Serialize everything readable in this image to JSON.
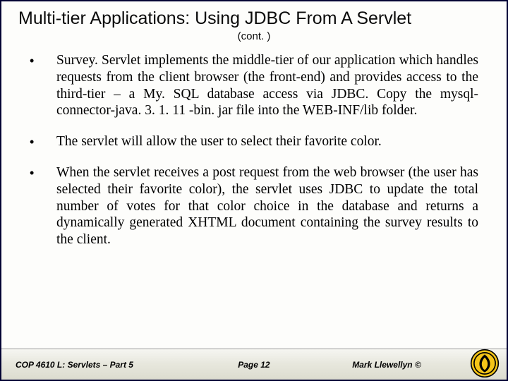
{
  "title": "Multi-tier Applications:  Using JDBC From A Servlet",
  "subtitle": "(cont. )",
  "bullets": [
    "Survey. Servlet implements the middle-tier of our application which handles requests from the client browser (the front-end) and provides access to the third-tier – a My. SQL database access via JDBC.  Copy the mysql-connector-java. 3. 1. 11 -bin. jar file into the WEB-INF/lib folder.",
    "The servlet will allow the user to select their favorite color.",
    "When the servlet receives a post request from the web browser (the user has selected their favorite color), the servlet uses JDBC to update the total number of votes for that color choice in the database and returns a dynamically generated XHTML document containing the survey results to the client."
  ],
  "footer": {
    "left": "COP 4610 L: Servlets – Part 5",
    "center": "Page 12",
    "right": "Mark Llewellyn ©"
  },
  "logo_name": "ucf-pegasus-logo"
}
